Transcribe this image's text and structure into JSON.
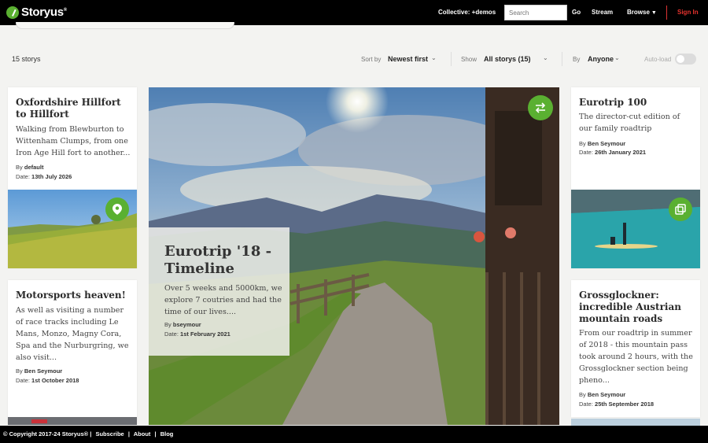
{
  "header": {
    "brand": "Storyus",
    "brand_mark": "®",
    "collective": "Collective: +demos",
    "search_placeholder": "Search",
    "go_label": "Go",
    "stream_label": "Stream",
    "browse_label": "Browse",
    "signin_label": "Sign In",
    "accent_color": "#5ab031",
    "signin_color": "#e8332e"
  },
  "filters": {
    "count": "15 storys",
    "sort_label": "Sort by",
    "sort_value": "Newest first",
    "show_label": "Show",
    "show_value": "All storys (15)",
    "by_label": "By",
    "by_value": "Anyone",
    "autoload_label": "Auto-load",
    "autoload_on": false
  },
  "cards": [
    {
      "title": "Oxfordshire Hillfort to Hillfort",
      "desc": "Walking from Blewburton to Wittenham Clumps, from one Iron Age Hill fort to another...",
      "by_label": "By",
      "author": "default",
      "date_label": "Date:",
      "date": "13th July 2026",
      "icon": "map-pin-icon"
    },
    {
      "title": "Motorsports heaven!",
      "desc": "As well as visiting a number of race tracks including Le Mans, Monzo, Magny Cora, Spa and the Nurburgring, we also visit...",
      "by_label": "By",
      "author": "Ben Seymour",
      "date_label": "Date:",
      "date": "1st October 2018"
    },
    {
      "title": "Eurotrip 100",
      "desc": "The director-cut edition of our family roadtrip",
      "by_label": "By",
      "author": "Ben Seymour",
      "date_label": "Date:",
      "date": "26th January 2021",
      "icon": "gallery-icon"
    },
    {
      "title": "Grossglockner: incredible Austrian mountain roads",
      "desc": "From our roadtrip in summer of 2018 - this mountain pass took around 2 hours, with the Grossglockner section being pheno...",
      "by_label": "By",
      "author": "Ben Seymour",
      "date_label": "Date:",
      "date": "25th September 2018"
    }
  ],
  "feature": {
    "title": "Eurotrip '18 - Timeline",
    "desc": "Over 5 weeks and 5000km, we explore 7 coutries and had the time of our lives....",
    "by_label": "By",
    "author": "bseymour",
    "date_label": "Date:",
    "date": "1st February 2021",
    "icon": "timeline-icon"
  },
  "footer": {
    "copyright": "© Copyright 2017-24 Storyus® |",
    "links": [
      "Subscribe",
      "About",
      "Blog"
    ],
    "sep": "|"
  }
}
